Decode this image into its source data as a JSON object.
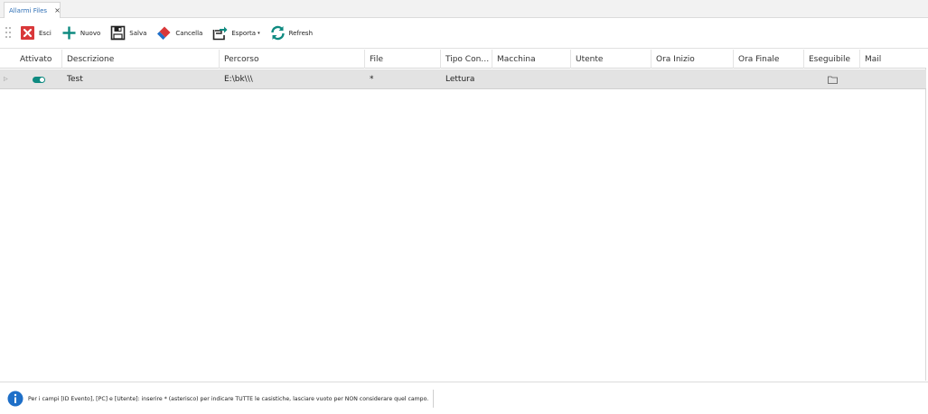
{
  "tab": {
    "label": "Allarmi Files",
    "close": "×"
  },
  "toolbar": {
    "esci": "Esci",
    "nuovo": "Nuovo",
    "salva": "Salva",
    "cancella": "Cancella",
    "esporta": "Esporta",
    "esporta_caret": "▾",
    "refresh": "Refresh"
  },
  "grid": {
    "columns": [
      "Attivato",
      "Descrizione",
      "Percorso",
      "File",
      "Tipo Con…",
      "Macchina",
      "Utente",
      "Ora Inizio",
      "Ora Finale",
      "Eseguibile",
      "Mail"
    ],
    "rows": [
      {
        "indicator": "▷",
        "attivato": true,
        "descrizione": "Test",
        "percorso": "E:\\bk\\\\\\",
        "file": "*",
        "tipo": "Lettura",
        "macchina": "",
        "utente": "",
        "ora_inizio": "",
        "ora_finale": "",
        "eseguibile_icon": "folder-icon",
        "mail": ""
      }
    ]
  },
  "status": {
    "icon": "info-icon",
    "text": "Per i campi [ID Evento], [PC] e [Utente]: inserire * (asterisco) per indicare TUTTE le casistiche, lasciare vuoto per NON considerare quel campo."
  },
  "colors": {
    "accent_teal": "#0e8a80",
    "delete_red": "#d9383a",
    "info_blue": "#1e6fc8",
    "row_selected": "#e3e3e3"
  }
}
